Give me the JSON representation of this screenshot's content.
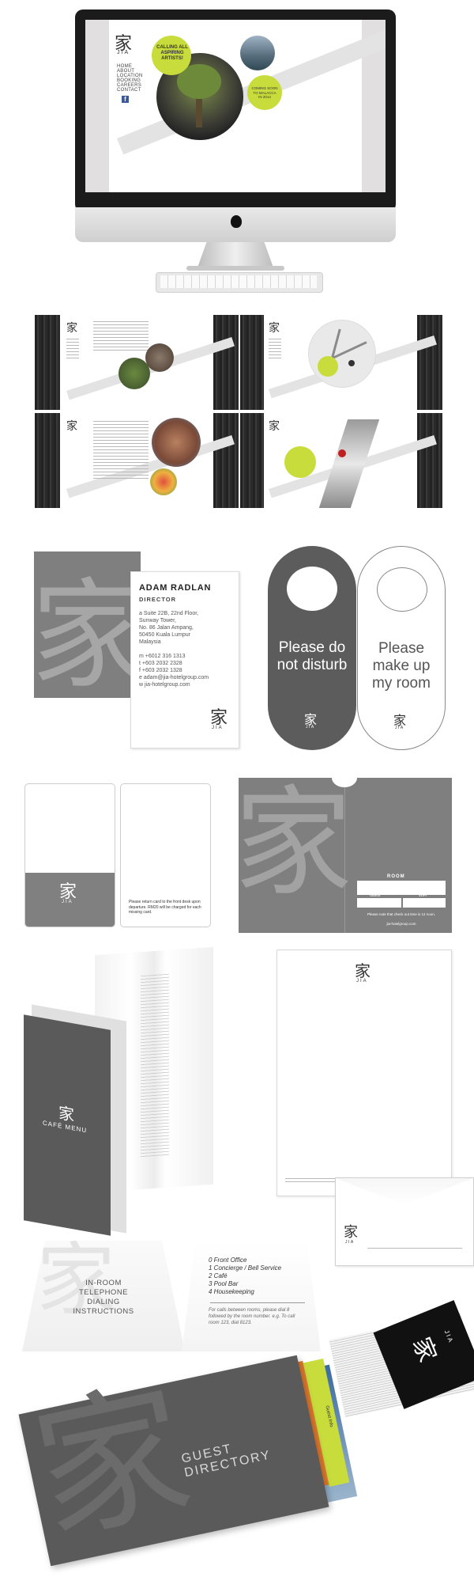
{
  "imac": {
    "logo_glyph": "家",
    "logo_text": "JIA",
    "nav": [
      "HOME",
      "ABOUT",
      "LOCATION",
      "BOOKING",
      "CAREERS",
      "CONTACT"
    ],
    "facebook": "f",
    "promo_1": "CALLING ALL ASPIRING ARTISTS!",
    "promo_2": "COMING SOON TO MALACCA IN 2014",
    "apple_logo": ""
  },
  "business_card": {
    "name": "ADAM RADLAN",
    "title": "DIRECTOR",
    "address": [
      "a  Suite 22B, 22nd Floor,",
      "Sunway Tower,",
      "No. 86 Jalan Ampang,",
      "50450 Kuala Lumpur",
      "Malaysia"
    ],
    "contacts": [
      "m  +6012 316 1313",
      "t   +603 2032 2328",
      "f   +603 2032 1328",
      "e  adam@jia-hotelgroup.com",
      "w  jia-hotelgroup.com"
    ],
    "logo_glyph": "家",
    "logo_text": "JIA"
  },
  "door_hangers": {
    "dark_text": "Please do not disturb",
    "light_text": "Please make up my room",
    "logo_glyph": "家",
    "logo_text": "JIA"
  },
  "keycard": {
    "logo_glyph": "家",
    "logo_text": "JIA",
    "back_text": "Please return card to the front desk upon departure. RM20 will be charged for each missing card."
  },
  "key_folder": {
    "room_label": "ROOM",
    "guest_label": "Guest",
    "wifi_label": "WiFi",
    "note": "Please note that check out time is 12 noon.",
    "url": "jia-hotelgroup.com"
  },
  "menu": {
    "logo_glyph": "家",
    "title": "CAFÉ MENU"
  },
  "letterhead": {
    "logo_glyph": "家",
    "logo_text": "JIA"
  },
  "envelope": {
    "logo_glyph": "家",
    "logo_text": "JIA"
  },
  "tent": {
    "left_text": "IN-ROOM TELEPHONE DIALING INSTRUCTIONS",
    "items": [
      "0  Front Office",
      "1  Concierge / Bell Service",
      "2  Café",
      "3  Pool Bar",
      "4  Housekeeping"
    ],
    "note": "For calls between rooms, please dial 8 followed by the room number. e.g. To call room 123, dial 8123."
  },
  "directory": {
    "title": "GUEST DIRECTORY",
    "tab_label": "Guest Info",
    "logo_glyph": "家",
    "logo_text": "JIA"
  },
  "colors": {
    "lime": "#c8dc3c",
    "grey": "#7f7f7f",
    "dark": "#555555"
  }
}
